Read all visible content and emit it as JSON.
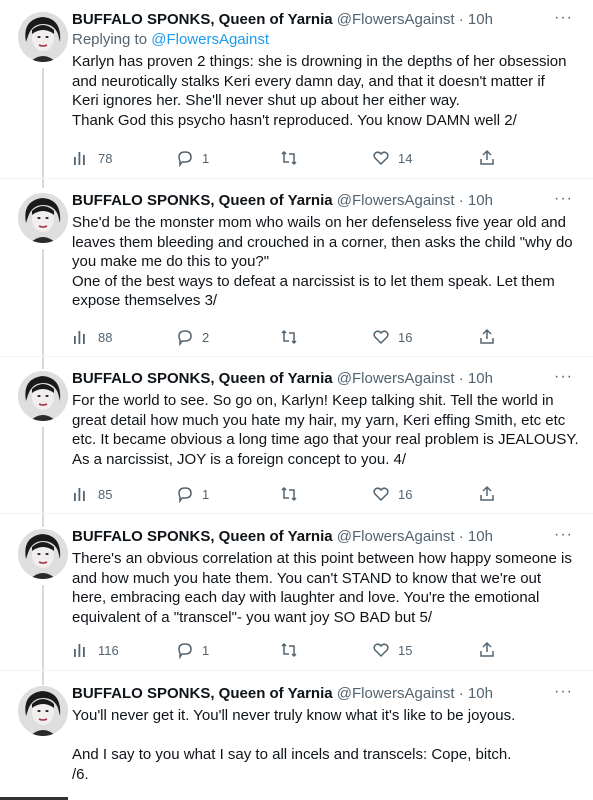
{
  "author": {
    "name": "BUFFALO SPONKS, Queen of Yarnia",
    "handle": "@FlowersAgainst",
    "avatar_icon": "avatar-icon"
  },
  "more_label": "···",
  "tweets": [
    {
      "time": "10h",
      "reply_prefix": "Replying to ",
      "reply_handle": "@FlowersAgainst",
      "text": "Karlyn has proven 2 things: she is drowning in the depths of her obsession\nand neurotically stalks Keri every damn day, and that it doesn't matter if\nKeri ignores her. She'll never shut up about her either way.\nThank God this psycho hasn't reproduced. You know DAMN well 2/",
      "views": "78",
      "replies": "1",
      "retweets": "",
      "likes": "14"
    },
    {
      "time": "10h",
      "text": "She'd be the monster mom who wails on her defenseless five year old and\nleaves them bleeding and crouched in a corner, then asks the child \"why do\nyou make me do this to you?\"\nOne of the best ways to defeat a narcissist is to let them speak. Let them\nexpose themselves 3/",
      "views": "88",
      "replies": "2",
      "retweets": "",
      "likes": "16"
    },
    {
      "time": "10h",
      "text": "For the world to see. So go on, Karlyn! Keep talking shit. Tell the world in\ngreat detail how much you hate my hair, my yarn, Keri effing Smith, etc etc\netc. It became obvious a long time ago that your real problem is JEALOUSY.\nAs a narcissist, JOY is a foreign concept to you. 4/",
      "views": "85",
      "replies": "1",
      "retweets": "",
      "likes": "16"
    },
    {
      "time": "10h",
      "text": "There's an obvious correlation at this point between how happy someone is\nand how much you hate them. You can't STAND to know that we're out\nhere, embracing each day with laughter and love. You're the emotional\nequivalent of a \"transcel\"- you want joy SO BAD but 5/",
      "views": "116",
      "replies": "1",
      "retweets": "",
      "likes": "15"
    },
    {
      "time": "10h",
      "text": "You'll never get it. You'll never truly know what it's like to be joyous.\n\nAnd I say to you what I say to all incels and transcels: Cope, bitch.\n/6."
    }
  ]
}
